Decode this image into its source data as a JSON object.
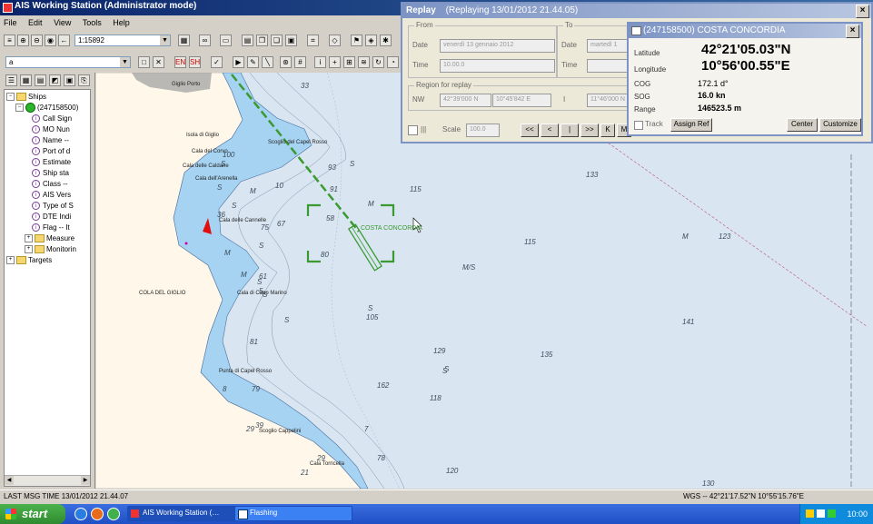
{
  "window": {
    "title": "AIS Working Station (Administrator mode)"
  },
  "menu": [
    "File",
    "Edit",
    "View",
    "Tools",
    "Help"
  ],
  "toolbar": {
    "scale_value": "1:15892",
    "layer_value": "a"
  },
  "tree": {
    "root": "Ships",
    "vessel_id": "(247158500)",
    "fields": [
      "Call Sign",
      "MO Nun",
      "Name --",
      "Port of d",
      "Estimate",
      "Ship sta",
      "Class --",
      "AIS Vers",
      "Type of S",
      "DTE Indi",
      "Flag -- It"
    ],
    "folders": [
      "Measure",
      "Monitorin"
    ],
    "targets": "Targets"
  },
  "status": {
    "last_msg_time": "LAST MSG TIME 13/01/2012 21.44.07",
    "wgs": "WGS -- 42°21'17.52\"N 10°55'15.76\"E"
  },
  "replay": {
    "title": "Replay",
    "subtitle": "(Replaying 13/01/2012 21.44.05)",
    "from_label": "From",
    "to_label": "To",
    "date_label": "Date",
    "time_label": "Time",
    "from_date": "venerdì 13 gennaio 2012",
    "from_time": "10.00.0",
    "to_date": "martedì 1",
    "region_label": "Region for replay",
    "nw_label": "NW",
    "nw_lat": "42°39'000 N",
    "nw_lon": "10°45'842 E",
    "i_label": "I",
    "se_lon": "11°46'000 N",
    "scale_label": "Scale",
    "scale_value": "100.0",
    "controls": [
      "<<",
      "<",
      "|",
      ">>",
      "K",
      "M"
    ]
  },
  "vessel_panel": {
    "title": "(247158500) COSTA CONCORDIA",
    "latitude_label": "Latitude",
    "latitude": "42°21'05.03\"N",
    "longitude_label": "Longitude",
    "longitude": "10°56'00.55\"E",
    "cog_label": "COG",
    "cog": "172.1 d°",
    "sog_label": "SOG",
    "sog": "16.0 kn",
    "range_label": "Range",
    "range": "146523.5 m",
    "track_label": "Track",
    "assign_ref": "Assign Ref",
    "center": "Center",
    "customize": "Customize"
  },
  "map": {
    "vessel_label": "COSTA CONCORDIA",
    "places": [
      "Giglio Porto",
      "Cala del Corvo",
      "Cala delle Caldane",
      "Cala dell'Arenella",
      "Scoglio del Capel Rosso",
      "Isola di Giglio",
      "COLA DEL GIGLIO",
      "Cala di Capo Marino",
      "Punta di Capel Rosso",
      "Cala Torricella",
      "Scoglio Cappelini",
      "Cala delle Cannelle"
    ],
    "depths": [
      "33",
      "S",
      "93",
      "91",
      "115",
      "133",
      "58",
      "80",
      "115",
      "M",
      "123",
      "M",
      "M/S",
      "S",
      "105",
      "141",
      "135",
      "129",
      "S",
      "162",
      "118",
      "S",
      "7",
      "78",
      "120",
      "130",
      "S",
      "M",
      "75",
      "S",
      "100",
      "S",
      "36",
      "S",
      "10",
      "S",
      "67",
      "61",
      "M",
      "S",
      "5",
      "M",
      "S",
      "81",
      "79",
      "8",
      "39",
      "29",
      "29",
      "21"
    ]
  },
  "taskbar": {
    "start": "start",
    "tasks": [
      "AIS Working Station (…",
      "Flashing"
    ],
    "clock": "10:00"
  },
  "colors": {
    "sea": "#d9e6f2",
    "shallow": "#a7d3f2",
    "land": "#fff8ea",
    "track": "#3a9a2f",
    "title_active": "#0a246a"
  }
}
